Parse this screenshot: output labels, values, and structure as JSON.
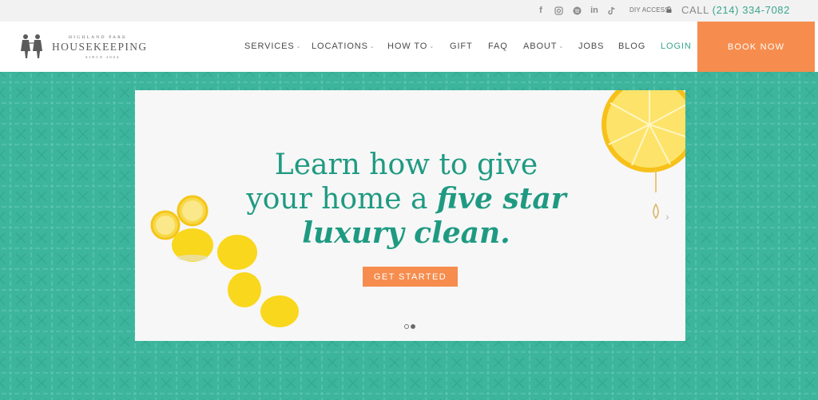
{
  "topbar": {
    "social_icons": [
      "facebook-icon",
      "instagram-icon",
      "spotify-icon",
      "linkedin-icon",
      "tiktok-icon"
    ],
    "diy_access": "DIY ACCESS",
    "call_label": "CALL",
    "phone": "(214) 334-7082"
  },
  "logo": {
    "small_text": "HIGHLAND PARK",
    "main_text": "HOUSEKEEPING",
    "since_text": "SINCE 2004"
  },
  "nav": {
    "services": "SERVICES",
    "locations": "LOCATIONS",
    "how_to": "HOW TO",
    "gift": "GIFT",
    "faq": "FAQ",
    "about": "ABOUT",
    "jobs": "JOBS",
    "blog": "BLOG",
    "login": "LOGIN",
    "book_now": "BOOK NOW"
  },
  "hero": {
    "line1": "Learn how to give",
    "line2_plain": "your home a ",
    "line2_bold": "five star",
    "line3": "luxury clean.",
    "cta": "GET STARTED",
    "slide_count": 2,
    "active_slide": 2
  },
  "colors": {
    "teal": "#3db59d",
    "teal_text": "#1f9a82",
    "orange": "#f68d4e"
  }
}
